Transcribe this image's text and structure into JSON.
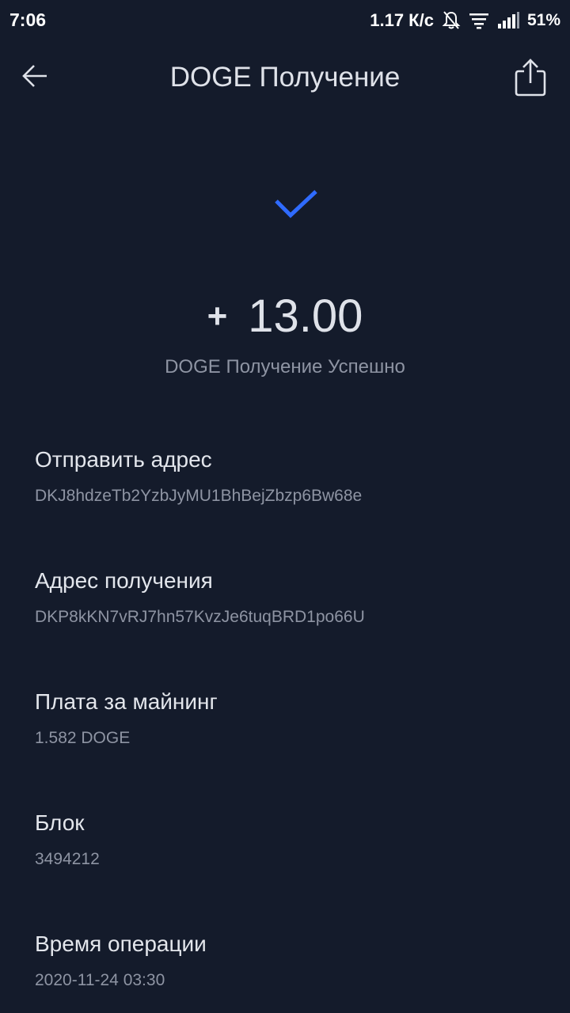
{
  "status_bar": {
    "time": "7:06",
    "speed": "1.17 К/с",
    "battery": "51%",
    "icons": [
      "bell-off-icon",
      "notification-list-icon",
      "signal-icon"
    ]
  },
  "header": {
    "title": "DOGE Получение",
    "back_icon": "arrow-left-icon",
    "share_icon": "share-icon"
  },
  "result": {
    "icon": "check-icon",
    "sign": "+",
    "amount": "13.00",
    "status": "DOGE Получение Успешно"
  },
  "details": [
    {
      "label": "Отправить адрес",
      "value": "DKJ8hdzeTb2YzbJyMU1BhBejZbzp6Bw68e"
    },
    {
      "label": "Адрес получения",
      "value": "DKP8kKN7vRJ7hn57KvzJe6tuqBRD1po66U"
    },
    {
      "label": "Плата за майнинг",
      "value": "1.582 DOGE"
    },
    {
      "label": "Блок",
      "value": "3494212"
    },
    {
      "label": "Время операции",
      "value": "2020-11-24 03:30"
    }
  ],
  "colors": {
    "background": "#141b2b",
    "accent": "#2f6bff",
    "text_primary": "#e3e6ec",
    "text_secondary": "#8e94a3"
  }
}
